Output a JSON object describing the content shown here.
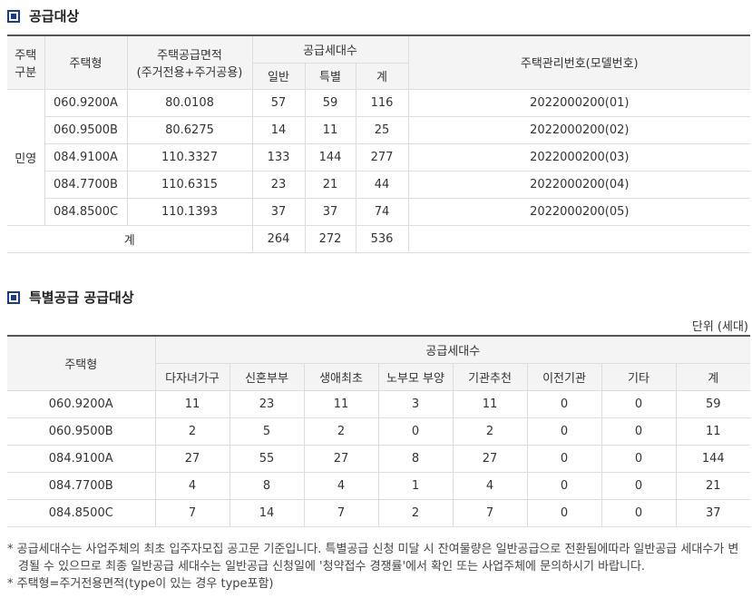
{
  "section1": {
    "title": "공급대상",
    "headers": {
      "type_group_line1": "주택",
      "type_group_line2": "구분",
      "housing_type": "주택형",
      "area_line1": "주택공급면적",
      "area_line2": "(주거전용+주거공용)",
      "units_group": "공급세대수",
      "general": "일반",
      "special": "특별",
      "total": "계",
      "mgmt_no": "주택관리번호(모델번호)"
    },
    "category": "민영",
    "rows": [
      {
        "type": "060.9200A",
        "area": "80.0108",
        "general": "57",
        "special": "59",
        "total": "116",
        "mgmt": "2022000200(01)"
      },
      {
        "type": "060.9500B",
        "area": "80.6275",
        "general": "14",
        "special": "11",
        "total": "25",
        "mgmt": "2022000200(02)"
      },
      {
        "type": "084.9100A",
        "area": "110.3327",
        "general": "133",
        "special": "144",
        "total": "277",
        "mgmt": "2022000200(03)"
      },
      {
        "type": "084.7700B",
        "area": "110.6315",
        "general": "23",
        "special": "21",
        "total": "44",
        "mgmt": "2022000200(04)"
      },
      {
        "type": "084.8500C",
        "area": "110.1393",
        "general": "37",
        "special": "37",
        "total": "74",
        "mgmt": "2022000200(05)"
      }
    ],
    "sum_row": {
      "label": "계",
      "general": "264",
      "special": "272",
      "total": "536"
    }
  },
  "section2": {
    "title": "특별공급 공급대상",
    "unit": "단위 (세대)",
    "headers": {
      "housing_type": "주택형",
      "units_group": "공급세대수",
      "cols": [
        "다자녀가구",
        "신혼부부",
        "생애최초",
        "노부모 부양",
        "기관추천",
        "이전기관",
        "기타",
        "계"
      ]
    },
    "rows": [
      {
        "type": "060.9200A",
        "values": [
          "11",
          "23",
          "11",
          "3",
          "11",
          "0",
          "0",
          "59"
        ]
      },
      {
        "type": "060.9500B",
        "values": [
          "2",
          "5",
          "2",
          "0",
          "2",
          "0",
          "0",
          "11"
        ]
      },
      {
        "type": "084.9100A",
        "values": [
          "27",
          "55",
          "27",
          "8",
          "27",
          "0",
          "0",
          "144"
        ]
      },
      {
        "type": "084.7700B",
        "values": [
          "4",
          "8",
          "4",
          "1",
          "4",
          "0",
          "0",
          "21"
        ]
      },
      {
        "type": "084.8500C",
        "values": [
          "7",
          "14",
          "7",
          "2",
          "7",
          "0",
          "0",
          "37"
        ]
      }
    ]
  },
  "notes": [
    "* 공급세대수는 사업주체의 최초 입주자모집 공고문 기준입니다. 특별공급 신청 미달 시 잔여물량은 일반공급으로 전환됨에따라 일반공급 세대수가 변경될 수 있으므로 최종 일반공급 세대수는 일반공급 신청일에 '청약접수 경쟁률'에서 확인 또는 사업주체에 문의하시기 바랍니다.",
    "* 주택형=주거전용면적(type이 있는 경우 type포함)"
  ],
  "colors": {
    "accent": "#1a3a8c",
    "header_bg": "#f4f4f4",
    "border": "#dddddd"
  },
  "icons": {
    "section_marker": "square-bullet-icon"
  }
}
